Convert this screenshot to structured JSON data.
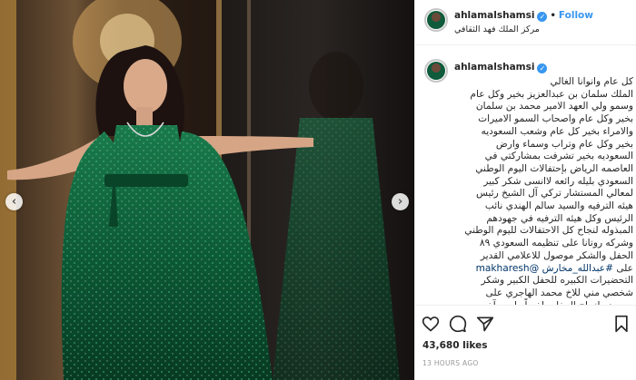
{
  "post": {
    "username": "ahlamalshamsi",
    "follow_label": "Follow",
    "dot": "•",
    "verified_mark": "✓",
    "location": "مركز الملك فهد الثقافي"
  },
  "caption": {
    "username": "ahlamalshamsi",
    "text_before_mention": "كل عام وانوانا الغالي\nالملك سلمان بن عبدالعزيز بخير وكل عام\nوسمو ولي العهد الامير محمد بن سلمان\nبخير وكل عام واصحاب السمو الاميرات\nوالامراء بخير كل عام وشعب السعوديه\nبخير وكل عام وتراب وسماء وارض\nالسعوديه بخير تشرفت بمشاركتي في\nالعاصمه الرياض بإحتفالات اليوم الوطني\nالسعودي بليله رائعه لاانسى شكر كبير\nلمعالي المستشار تركي آل الشيخ رئيس\nهيئه الترفيه والسيد سالم الهندي نائب\nالرئيس وكل هيئه الترفيه في جهودهم\nالمبذوله لنجاح كل الاحتفالات لليوم الوطني\nوشركه روتانا على تنظيمه السعودي ٨٩\nالحفل والشكر موصول للاعلامي القدير\nعلى ",
    "mention": "@makharesh",
    "hashtag": "#عبدالله_مخارش",
    "text_after_mention": "\nالتحضيرات الكبيره للحفل الكبير وشكر\nشخصي مني للاخ محمد الهاجري على\nمجهوده لنجاح الحفل واخيراً وليس آخر\nالشكر الكبير ..."
  },
  "actions": {
    "like_icon": "heart-icon",
    "comment_icon": "comment-icon",
    "share_icon": "share-icon",
    "save_icon": "bookmark-icon",
    "likes_text": "43,680 likes",
    "timestamp": "13 HOURS AGO"
  },
  "photo": {
    "prev_arrow": "‹",
    "next_arrow": "›",
    "dress_color": "#0d5a36",
    "background_color": "#1c1511"
  }
}
